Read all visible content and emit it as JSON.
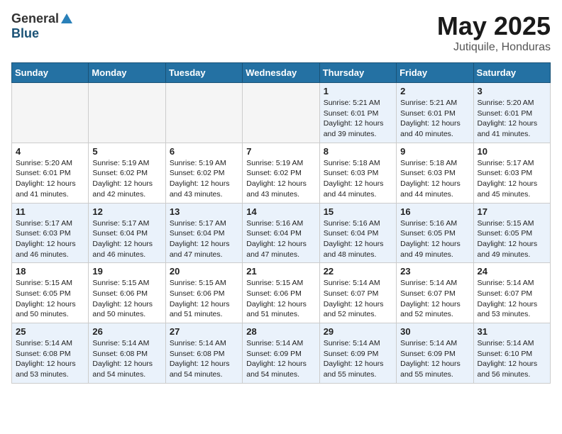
{
  "header": {
    "logo_general": "General",
    "logo_blue": "Blue",
    "title": "May 2025",
    "subtitle": "Jutiquile, Honduras"
  },
  "days_of_week": [
    "Sunday",
    "Monday",
    "Tuesday",
    "Wednesday",
    "Thursday",
    "Friday",
    "Saturday"
  ],
  "weeks": [
    [
      {
        "day": "",
        "info": ""
      },
      {
        "day": "",
        "info": ""
      },
      {
        "day": "",
        "info": ""
      },
      {
        "day": "",
        "info": ""
      },
      {
        "day": "1",
        "info": "Sunrise: 5:21 AM\nSunset: 6:01 PM\nDaylight: 12 hours\nand 39 minutes."
      },
      {
        "day": "2",
        "info": "Sunrise: 5:21 AM\nSunset: 6:01 PM\nDaylight: 12 hours\nand 40 minutes."
      },
      {
        "day": "3",
        "info": "Sunrise: 5:20 AM\nSunset: 6:01 PM\nDaylight: 12 hours\nand 41 minutes."
      }
    ],
    [
      {
        "day": "4",
        "info": "Sunrise: 5:20 AM\nSunset: 6:01 PM\nDaylight: 12 hours\nand 41 minutes."
      },
      {
        "day": "5",
        "info": "Sunrise: 5:19 AM\nSunset: 6:02 PM\nDaylight: 12 hours\nand 42 minutes."
      },
      {
        "day": "6",
        "info": "Sunrise: 5:19 AM\nSunset: 6:02 PM\nDaylight: 12 hours\nand 43 minutes."
      },
      {
        "day": "7",
        "info": "Sunrise: 5:19 AM\nSunset: 6:02 PM\nDaylight: 12 hours\nand 43 minutes."
      },
      {
        "day": "8",
        "info": "Sunrise: 5:18 AM\nSunset: 6:03 PM\nDaylight: 12 hours\nand 44 minutes."
      },
      {
        "day": "9",
        "info": "Sunrise: 5:18 AM\nSunset: 6:03 PM\nDaylight: 12 hours\nand 44 minutes."
      },
      {
        "day": "10",
        "info": "Sunrise: 5:17 AM\nSunset: 6:03 PM\nDaylight: 12 hours\nand 45 minutes."
      }
    ],
    [
      {
        "day": "11",
        "info": "Sunrise: 5:17 AM\nSunset: 6:03 PM\nDaylight: 12 hours\nand 46 minutes."
      },
      {
        "day": "12",
        "info": "Sunrise: 5:17 AM\nSunset: 6:04 PM\nDaylight: 12 hours\nand 46 minutes."
      },
      {
        "day": "13",
        "info": "Sunrise: 5:17 AM\nSunset: 6:04 PM\nDaylight: 12 hours\nand 47 minutes."
      },
      {
        "day": "14",
        "info": "Sunrise: 5:16 AM\nSunset: 6:04 PM\nDaylight: 12 hours\nand 47 minutes."
      },
      {
        "day": "15",
        "info": "Sunrise: 5:16 AM\nSunset: 6:04 PM\nDaylight: 12 hours\nand 48 minutes."
      },
      {
        "day": "16",
        "info": "Sunrise: 5:16 AM\nSunset: 6:05 PM\nDaylight: 12 hours\nand 49 minutes."
      },
      {
        "day": "17",
        "info": "Sunrise: 5:15 AM\nSunset: 6:05 PM\nDaylight: 12 hours\nand 49 minutes."
      }
    ],
    [
      {
        "day": "18",
        "info": "Sunrise: 5:15 AM\nSunset: 6:05 PM\nDaylight: 12 hours\nand 50 minutes."
      },
      {
        "day": "19",
        "info": "Sunrise: 5:15 AM\nSunset: 6:06 PM\nDaylight: 12 hours\nand 50 minutes."
      },
      {
        "day": "20",
        "info": "Sunrise: 5:15 AM\nSunset: 6:06 PM\nDaylight: 12 hours\nand 51 minutes."
      },
      {
        "day": "21",
        "info": "Sunrise: 5:15 AM\nSunset: 6:06 PM\nDaylight: 12 hours\nand 51 minutes."
      },
      {
        "day": "22",
        "info": "Sunrise: 5:14 AM\nSunset: 6:07 PM\nDaylight: 12 hours\nand 52 minutes."
      },
      {
        "day": "23",
        "info": "Sunrise: 5:14 AM\nSunset: 6:07 PM\nDaylight: 12 hours\nand 52 minutes."
      },
      {
        "day": "24",
        "info": "Sunrise: 5:14 AM\nSunset: 6:07 PM\nDaylight: 12 hours\nand 53 minutes."
      }
    ],
    [
      {
        "day": "25",
        "info": "Sunrise: 5:14 AM\nSunset: 6:08 PM\nDaylight: 12 hours\nand 53 minutes."
      },
      {
        "day": "26",
        "info": "Sunrise: 5:14 AM\nSunset: 6:08 PM\nDaylight: 12 hours\nand 54 minutes."
      },
      {
        "day": "27",
        "info": "Sunrise: 5:14 AM\nSunset: 6:08 PM\nDaylight: 12 hours\nand 54 minutes."
      },
      {
        "day": "28",
        "info": "Sunrise: 5:14 AM\nSunset: 6:09 PM\nDaylight: 12 hours\nand 54 minutes."
      },
      {
        "day": "29",
        "info": "Sunrise: 5:14 AM\nSunset: 6:09 PM\nDaylight: 12 hours\nand 55 minutes."
      },
      {
        "day": "30",
        "info": "Sunrise: 5:14 AM\nSunset: 6:09 PM\nDaylight: 12 hours\nand 55 minutes."
      },
      {
        "day": "31",
        "info": "Sunrise: 5:14 AM\nSunset: 6:10 PM\nDaylight: 12 hours\nand 56 minutes."
      }
    ]
  ]
}
